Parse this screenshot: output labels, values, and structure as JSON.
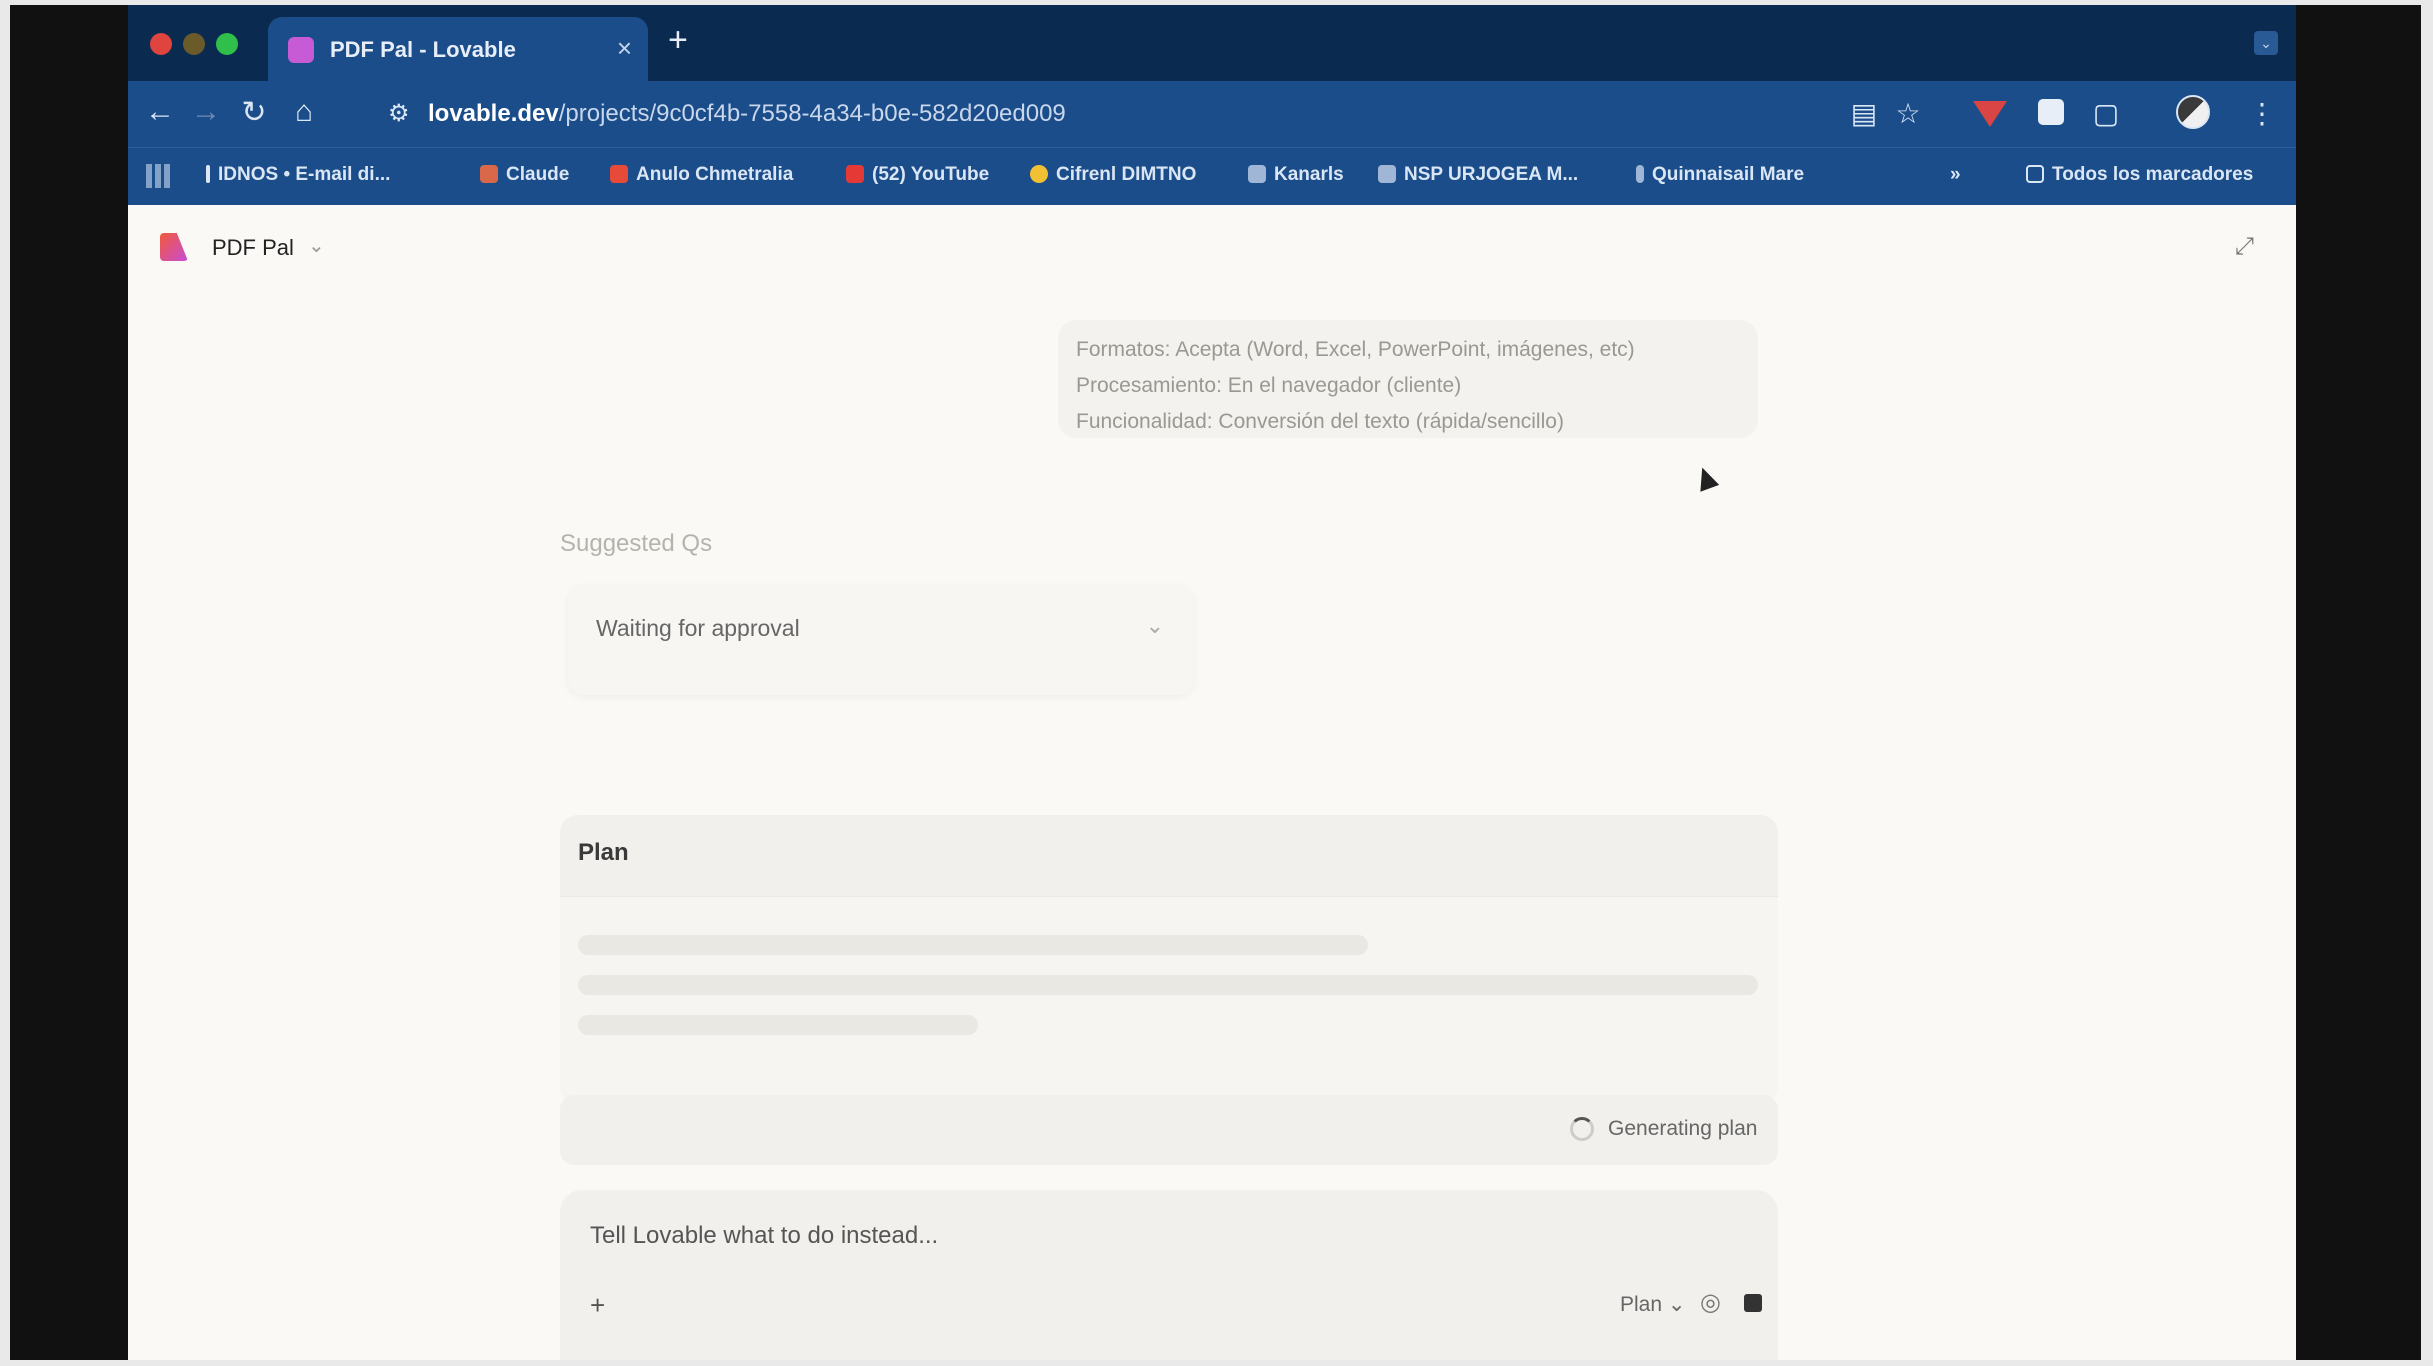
{
  "browser": {
    "tab_title": "PDF Pal - Lovable",
    "tab_close": "×",
    "new_tab": "+",
    "url_domain": "lovable.dev",
    "url_path": "/projects/9c0cf4b-7558-4a34-b0e-582d20ed009",
    "bookmarks": [
      {
        "label": "IDNOS • E-mail di...",
        "color": "#dbe6f5"
      },
      {
        "label": "Claude",
        "color": "#d9674a"
      },
      {
        "label": "Anulo Chmetralia",
        "color": "#e84a3a"
      },
      {
        "label": "(52) YouTube",
        "color": "#e53935"
      },
      {
        "label": "Cifrenl DIMTNO",
        "color": "#f2c033"
      },
      {
        "label": "Kanarls",
        "color": "#9fb6d6"
      },
      {
        "label": "NSP URJOGEA M...",
        "color": "#9fb6d6"
      },
      {
        "label": "Quinnaisail Mare",
        "color": "#9fb6d6"
      }
    ],
    "bookmarks_more": "»",
    "other_bookmarks": "Todos los marcadores"
  },
  "project": {
    "name": "PDF Pal",
    "chevron": "⌄"
  },
  "user_message": [
    "Formatos: Acepta (Word, Excel, PowerPoint, imágenes, etc)",
    "Procesamiento: En el navegador (cliente)",
    "Funcionalidad: Conversión del texto (rápida/sencillo)"
  ],
  "suggestion": {
    "label": "Suggested Qs",
    "status": "Waiting for approval",
    "chevron": "⌄"
  },
  "plan": {
    "title": "Plan"
  },
  "generating": {
    "text": "Generating plan"
  },
  "chat": {
    "placeholder": "Tell Lovable what to do instead...",
    "plus": "+",
    "mode": "Plan ⌄"
  }
}
